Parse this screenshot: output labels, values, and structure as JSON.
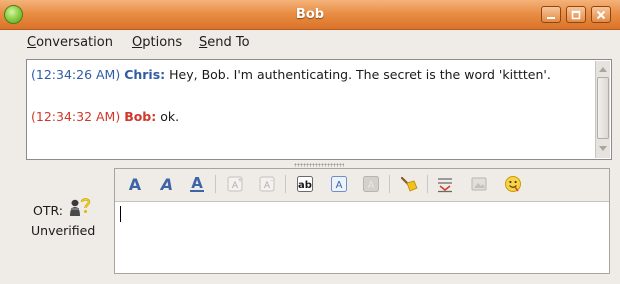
{
  "window": {
    "title": "Bob",
    "controls": [
      "minimize-icon",
      "maximize-icon",
      "close-icon"
    ]
  },
  "menu": {
    "items": [
      {
        "mnemonic": "C",
        "rest": "onversation"
      },
      {
        "mnemonic": "O",
        "rest": "ptions"
      },
      {
        "mnemonic": "S",
        "rest": "end To"
      }
    ]
  },
  "history": {
    "messages": [
      {
        "timestamp": "(12:34:26 AM)",
        "sender": "Chris:",
        "text": " Hey, Bob.  I'm authenticating.  The secret is the word 'kittten'.",
        "color": "#2f5da3"
      },
      {
        "timestamp": "(12:34:32 AM)",
        "sender": "Bob:",
        "text": " ok.",
        "color": "#d1382c"
      }
    ]
  },
  "otr": {
    "label": "OTR:",
    "status": "Unverified",
    "icon": "otr-unverified-icon"
  },
  "toolbar": {
    "icons": [
      "bold-icon",
      "italic-icon",
      "underline-icon",
      "font-grow-icon",
      "font-shrink-icon",
      "font-face-icon",
      "fg-color-icon",
      "bg-color-icon",
      "clear-format-icon",
      "insert-rule-icon",
      "insert-image-icon",
      "smiley-icon"
    ]
  },
  "entry": {
    "value": ""
  },
  "colors": {
    "titlebar": "#e88f45",
    "chris": "#2f5da3",
    "bob": "#d1382c",
    "status_online": "#8fd14a"
  }
}
